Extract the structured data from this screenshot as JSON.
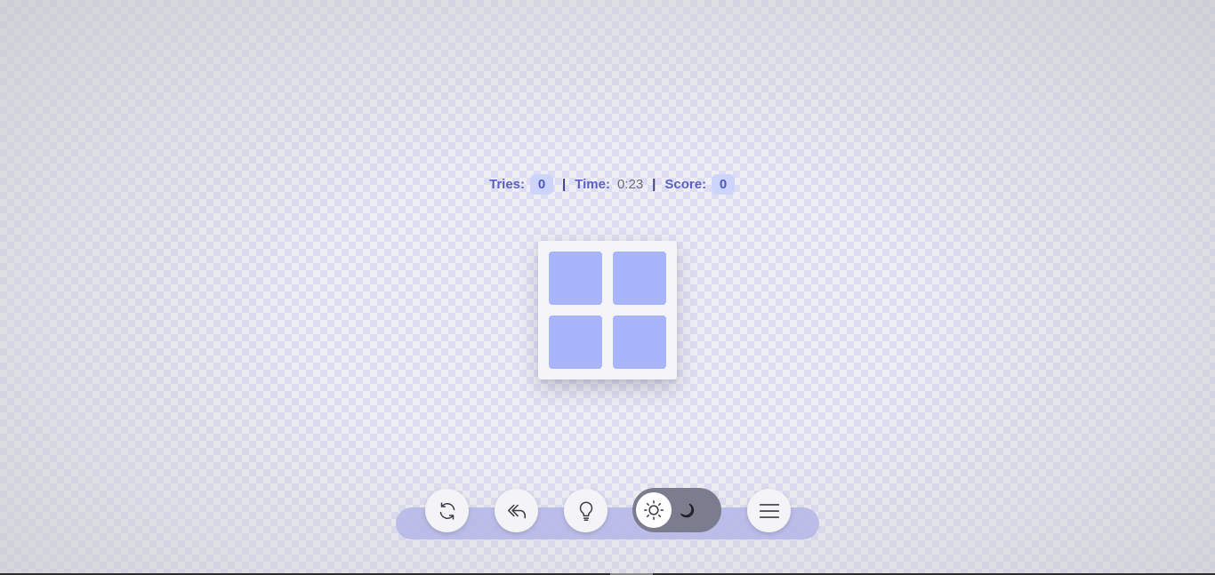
{
  "stats": {
    "tries_label": "Tries:",
    "tries_value": "0",
    "separator": "|",
    "time_label": "Time:",
    "time_value": "0:23",
    "score_label": "Score:",
    "score_value": "0"
  },
  "board": {
    "rows": 2,
    "cols": 2,
    "tile_color": "#a8b4fb"
  },
  "toolbar": {
    "buttons": [
      {
        "name": "restart",
        "icon": "refresh-icon"
      },
      {
        "name": "undo",
        "icon": "undo-arrow-icon"
      },
      {
        "name": "hint",
        "icon": "lightbulb-icon"
      },
      {
        "name": "theme",
        "icon": "sun-icon",
        "alt_icon": "moon-icon",
        "state": "light"
      },
      {
        "name": "menu",
        "icon": "hamburger-menu-icon"
      }
    ]
  },
  "colors": {
    "accent": "#5b60c4",
    "badge_bg": "#cdd4fb",
    "toolbar_track": "#b4b6e8",
    "toggle_bg": "#7b7d8f"
  }
}
